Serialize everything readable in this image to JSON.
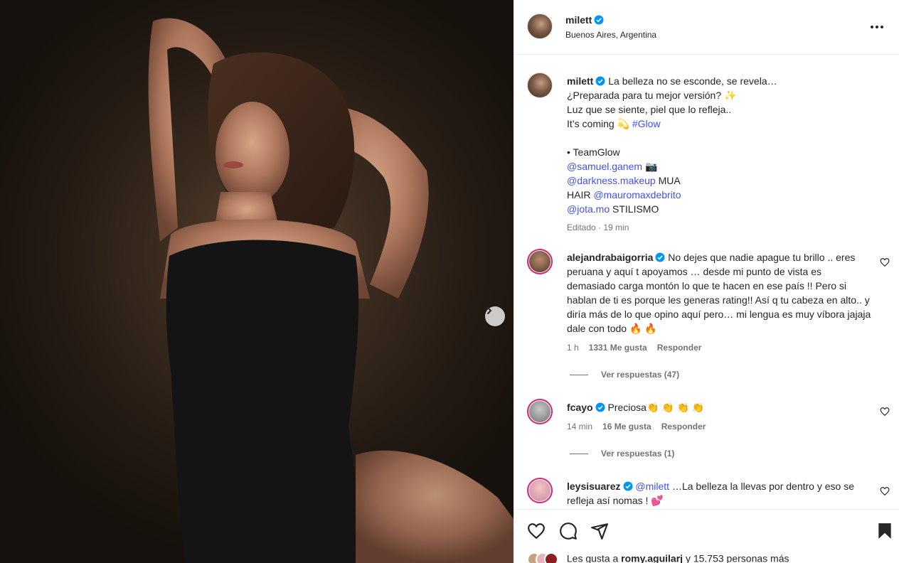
{
  "post": {
    "author": "milett",
    "location": "Buenos Aires, Argentina",
    "caption_lines": [
      "La belleza no se esconde, se revela…",
      "¿Preparada para tu mejor versión? ✨",
      "Luz que se siente, piel que lo refleja..",
      "It’s coming 💫",
      "• TeamGlow",
      "MUA",
      "HAIR",
      "STILISMO"
    ],
    "hashtag": "#Glow",
    "mentions": [
      "@samuel.ganem",
      "@darkness.makeup",
      "@mauromaxdebrito",
      "@jota.mo"
    ],
    "camera_emoji": "📷",
    "edited_meta": "Editado · 19 min"
  },
  "comments": [
    {
      "user": "alejandrabaigorria",
      "text": "No dejes que nadie apague tu brillo .. eres peruana y aquí t apoyamos … desde mi punto de vista es demasiado carga montón lo que te hacen en ese país !! Pero si hablan de ti es porque les generas rating!! Así q tu cabeza en alto.. y diría más de lo que opino aquí pero… mi lengua es muy víbora jajaja dale con todo 🔥 🔥",
      "time": "1 h",
      "likes": "1331 Me gusta",
      "reply": "Responder",
      "view_replies": "Ver respuestas (47)"
    },
    {
      "user": "fcayo",
      "text": "Preciosa👏 👏 👏 👏",
      "time": "14 min",
      "likes": "16 Me gusta",
      "reply": "Responder",
      "view_replies": "Ver respuestas (1)"
    },
    {
      "user": "leysisuarez",
      "mention": "@milett",
      "text": "…La belleza la llevas por dentro y eso se refleja así nomas ! 💕"
    }
  ],
  "footer": {
    "likes_prefix": "Les gusta a",
    "likes_user": "romy.aguilarj",
    "likes_suffix": "y 15.753 personas más"
  },
  "icons": [
    "verified-icon",
    "more-icon",
    "heart-icon",
    "comment-icon",
    "share-icon",
    "bookmark-icon",
    "chevron-right-icon"
  ],
  "colors": {
    "link": "#4150f7",
    "verified": "#0095f6",
    "story_ring": "#d62976"
  }
}
